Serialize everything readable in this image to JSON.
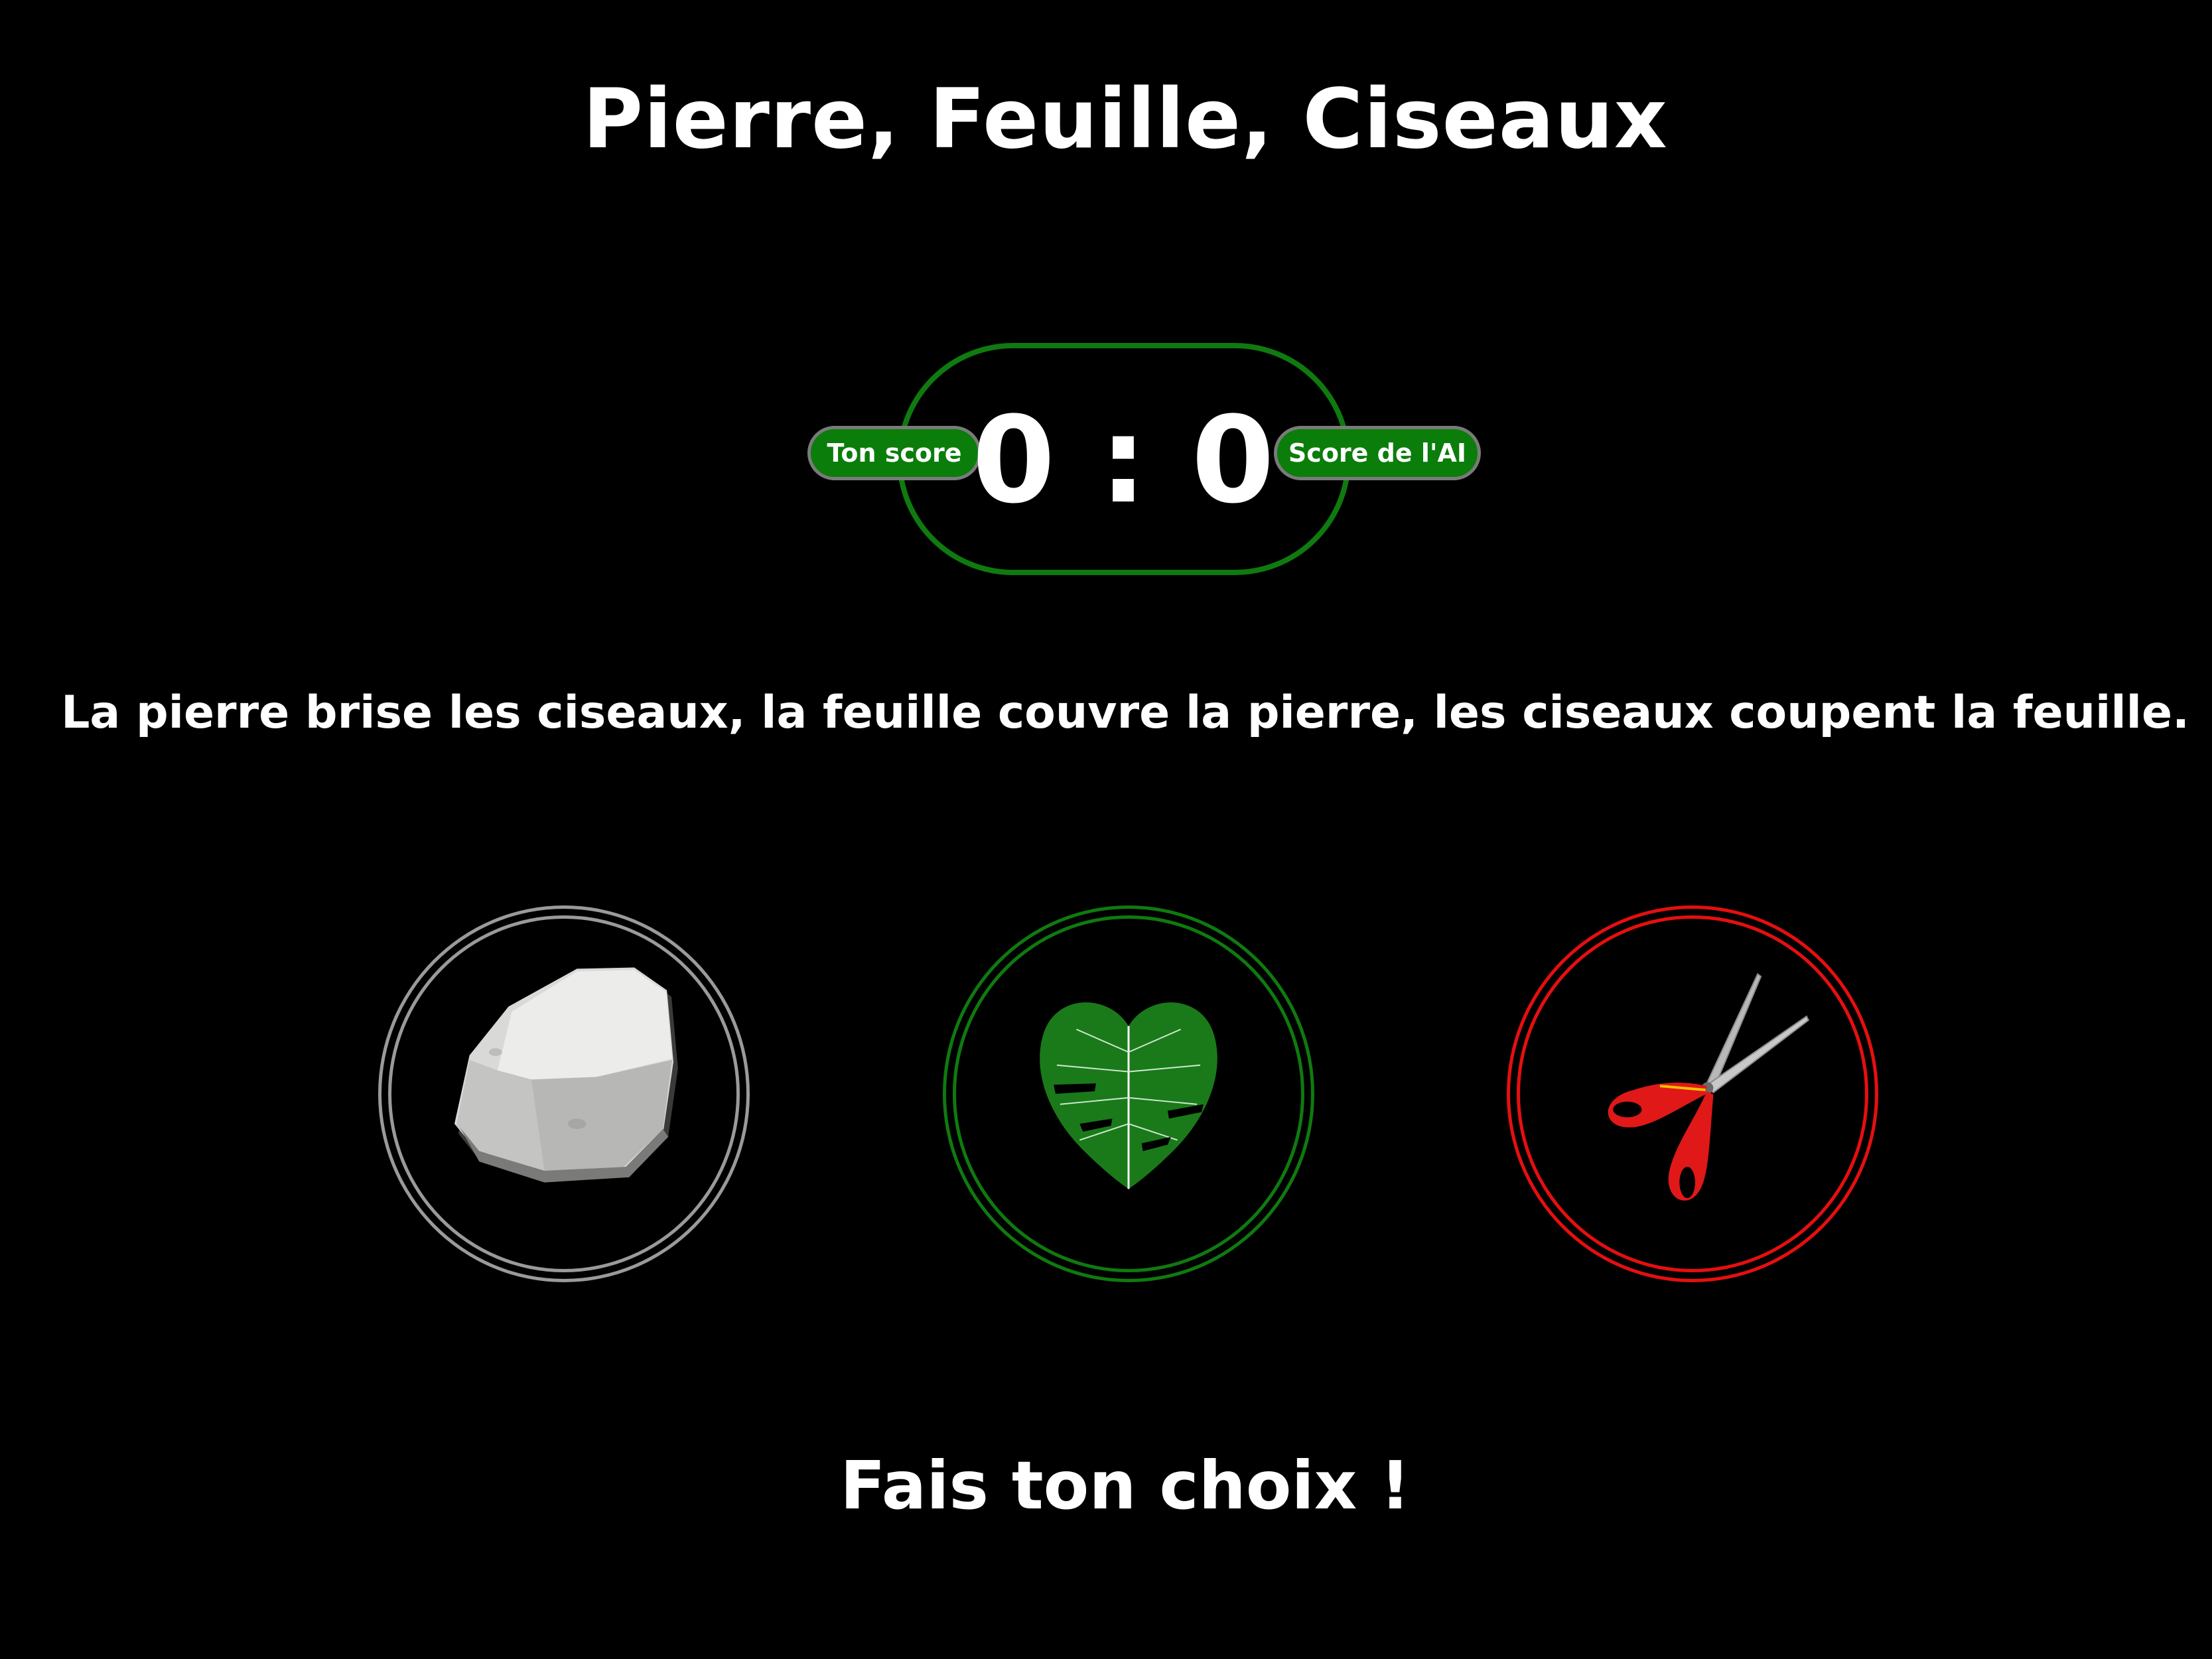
{
  "title": "Pierre, Feuille, Ciseaux",
  "score": {
    "user_label": "Ton score",
    "ai_label": "Score de l'AI",
    "user": 0,
    "ai": 0,
    "separator": ":",
    "display": "0 : 0"
  },
  "rules": "La pierre brise les ciseaux, la feuille couvre la pierre, les ciseaux coupent la feuille.",
  "choices": [
    {
      "id": "rock",
      "icon": "rock-icon",
      "border_color": "#9a9a9a"
    },
    {
      "id": "paper",
      "icon": "leaf-icon",
      "border_color": "#0f7a0f"
    },
    {
      "id": "scissors",
      "icon": "scissors-icon",
      "border_color": "#e60f0f"
    }
  ],
  "prompt": "Fais ton choix !",
  "colors": {
    "background": "#000000",
    "accent_green": "#0b7d0b",
    "text": "#ffffff"
  }
}
